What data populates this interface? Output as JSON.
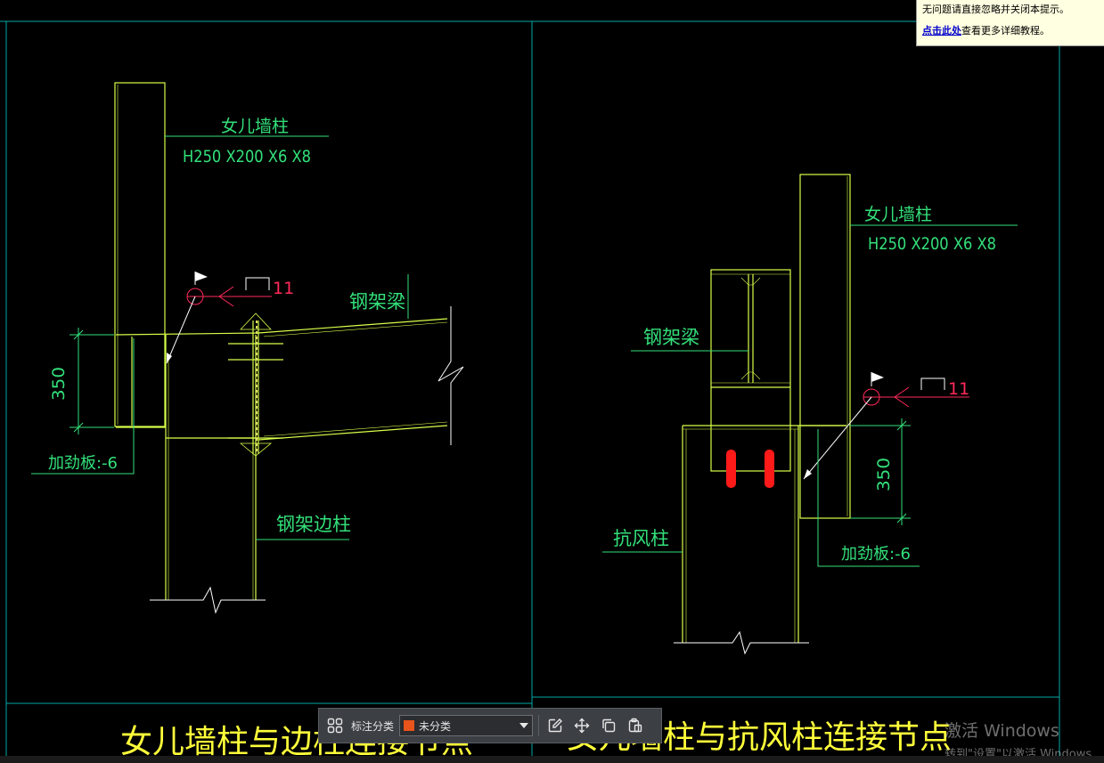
{
  "colors": {
    "background": "#000000",
    "frame": "#00a8a8",
    "outline": "#d8ff4a",
    "label": "#33e07a",
    "dimension": "#33e07a",
    "title": "#ffff3a",
    "flag_red": "#ff2a5a",
    "bolt_red": "#ff1a1a"
  },
  "drawing": {
    "left_detail": {
      "column_label": "女儿墙柱",
      "column_spec": "H250 X200 X6 X8",
      "beam_label": "钢架梁",
      "edge_column_label": "钢架边柱",
      "dimension": "350",
      "stiffener_label": "加劲板:-6",
      "weld_number": "11",
      "title": "女儿墙柱与边柱连接节点"
    },
    "right_detail": {
      "column_label": "女儿墙柱",
      "column_spec": "H250 X200 X6 X8",
      "beam_label": "钢架梁",
      "wind_column_label": "抗风柱",
      "dimension": "350",
      "stiffener_label": "加劲板:-6",
      "weld_number": "11",
      "title": "女儿墙柱与抗风柱连接节点"
    }
  },
  "tooltip": {
    "line1": "无问题请直接忽略并关闭本提示。",
    "link": "点击此处",
    "line2_rest": "查看更多详细教程。"
  },
  "toolbar": {
    "grid_icon": "grid-icon",
    "category_label": "标注分类",
    "category_value": "未分类",
    "category_color": "#e8541b",
    "edit_icon": "edit-icon",
    "move_icon": "move-icon",
    "copy_icon": "copy-icon",
    "paste_icon": "paste-icon"
  },
  "watermark": {
    "line1": "激活 Windows",
    "line2": "转到\"设置\"以激活 Windows"
  }
}
